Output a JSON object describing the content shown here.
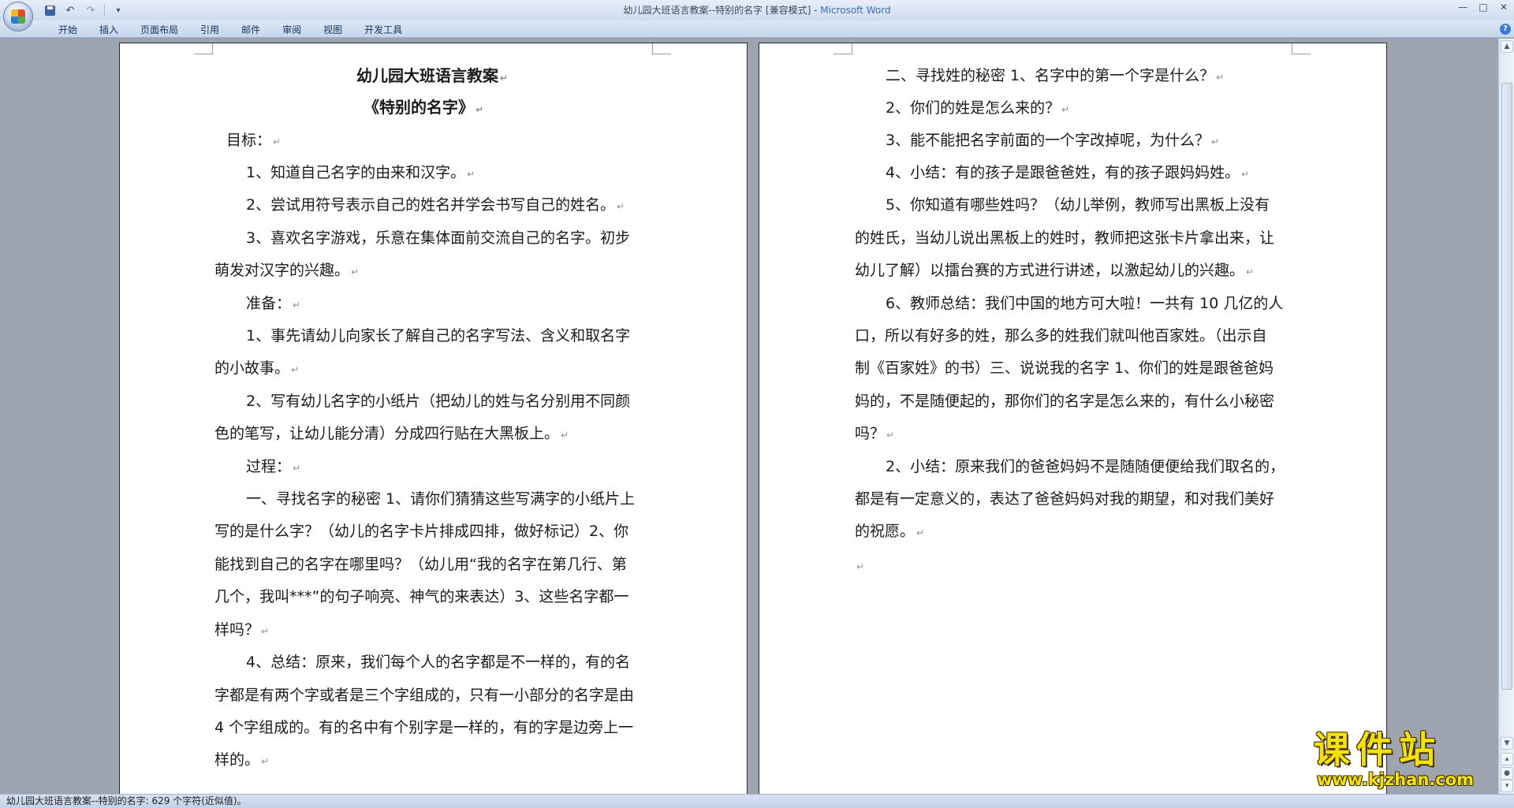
{
  "window": {
    "title_doc": "幼儿园大班语言教案--特别的名字 [兼容模式] - ",
    "title_app": "Microsoft Word",
    "minimize_glyph": "—",
    "maximize_glyph": "□",
    "close_glyph": "✕"
  },
  "qat": {
    "undo_glyph": "↶",
    "redo_glyph": "↷",
    "dropdown_glyph": "▾"
  },
  "ribbon": {
    "tabs": [
      "开始",
      "插入",
      "页面布局",
      "引用",
      "邮件",
      "审阅",
      "视图",
      "开发工具"
    ],
    "help_glyph": "?"
  },
  "document": {
    "left_page": {
      "title": "幼儿园大班语言教案",
      "subtitle": "《特别的名字》",
      "lines": [
        "目标：",
        "1、知道自己名字的由来和汉字。",
        "2、尝试用符号表示自己的姓名并学会书写自己的姓名。",
        "3、喜欢名字游戏，乐意在集体面前交流自己的名字。初步",
        "萌发对汉字的兴趣。",
        "准备：",
        "1、事先请幼儿向家长了解自己的名字写法、含义和取名字",
        "的小故事。",
        "2、写有幼儿名字的小纸片（把幼儿的姓与名分别用不同颜",
        "色的笔写，让幼儿能分清）分成四行贴在大黑板上。",
        "过程：",
        "一、寻找名字的秘密 1、请你们猜猜这些写满字的小纸片上",
        "写的是什么字？（幼儿的名字卡片排成四排，做好标记）2、你",
        "能找到自己的名字在哪里吗？（幼儿用“我的名字在第几行、第",
        "几个，我叫***”的句子响亮、神气的来表达）3、这些名字都一",
        "样吗？",
        "4、总结：原来，我们每个人的名字都是不一样的，有的名",
        "字都是有两个字或者是三个字组成的，只有一小部分的名字是由",
        "4 个字组成的。有的名中有个别字是一样的，有的字是边旁上一",
        "样的。"
      ]
    },
    "right_page": {
      "lines": [
        "二、寻找姓的秘密 1、名字中的第一个字是什么？",
        "2、你们的姓是怎么来的？",
        "3、能不能把名字前面的一个字改掉呢，为什么？",
        "4、小结：有的孩子是跟爸爸姓，有的孩子跟妈妈姓。",
        "5、你知道有哪些姓吗？（幼儿举例，教师写出黑板上没有",
        "的姓氏，当幼儿说出黑板上的姓时，教师把这张卡片拿出来，让",
        "幼儿了解）以擂台赛的方式进行讲述，以激起幼儿的兴趣。",
        "6、教师总结：我们中国的地方可大啦！一共有 10 几亿的人",
        "口，所以有好多的姓，那么多的姓我们就叫他百家姓。（出示自",
        "制《百家姓》的书）三、说说我的名字 1、你们的姓是跟爸爸妈",
        "妈的，不是随便起的，那你们的名字是怎么来的，有什么小秘密",
        "吗？",
        "2、小结：原来我们的爸爸妈妈不是随随便便给我们取名的，",
        "都是有一定意义的，表达了爸爸妈妈对我的期望，和对我们美好",
        "的祝愿。"
      ]
    },
    "para_mark": "↵"
  },
  "scrollbar": {
    "up_glyph": "▲",
    "down_glyph": "▼",
    "prev_page_glyph": "▴",
    "next_page_glyph": "▾"
  },
  "statusbar": {
    "text": "幼儿园大班语言教案--特别的名字: 629 个字符(近似值)。"
  },
  "watermark": {
    "text": "课件站",
    "url": "www.kjzhan.com"
  }
}
